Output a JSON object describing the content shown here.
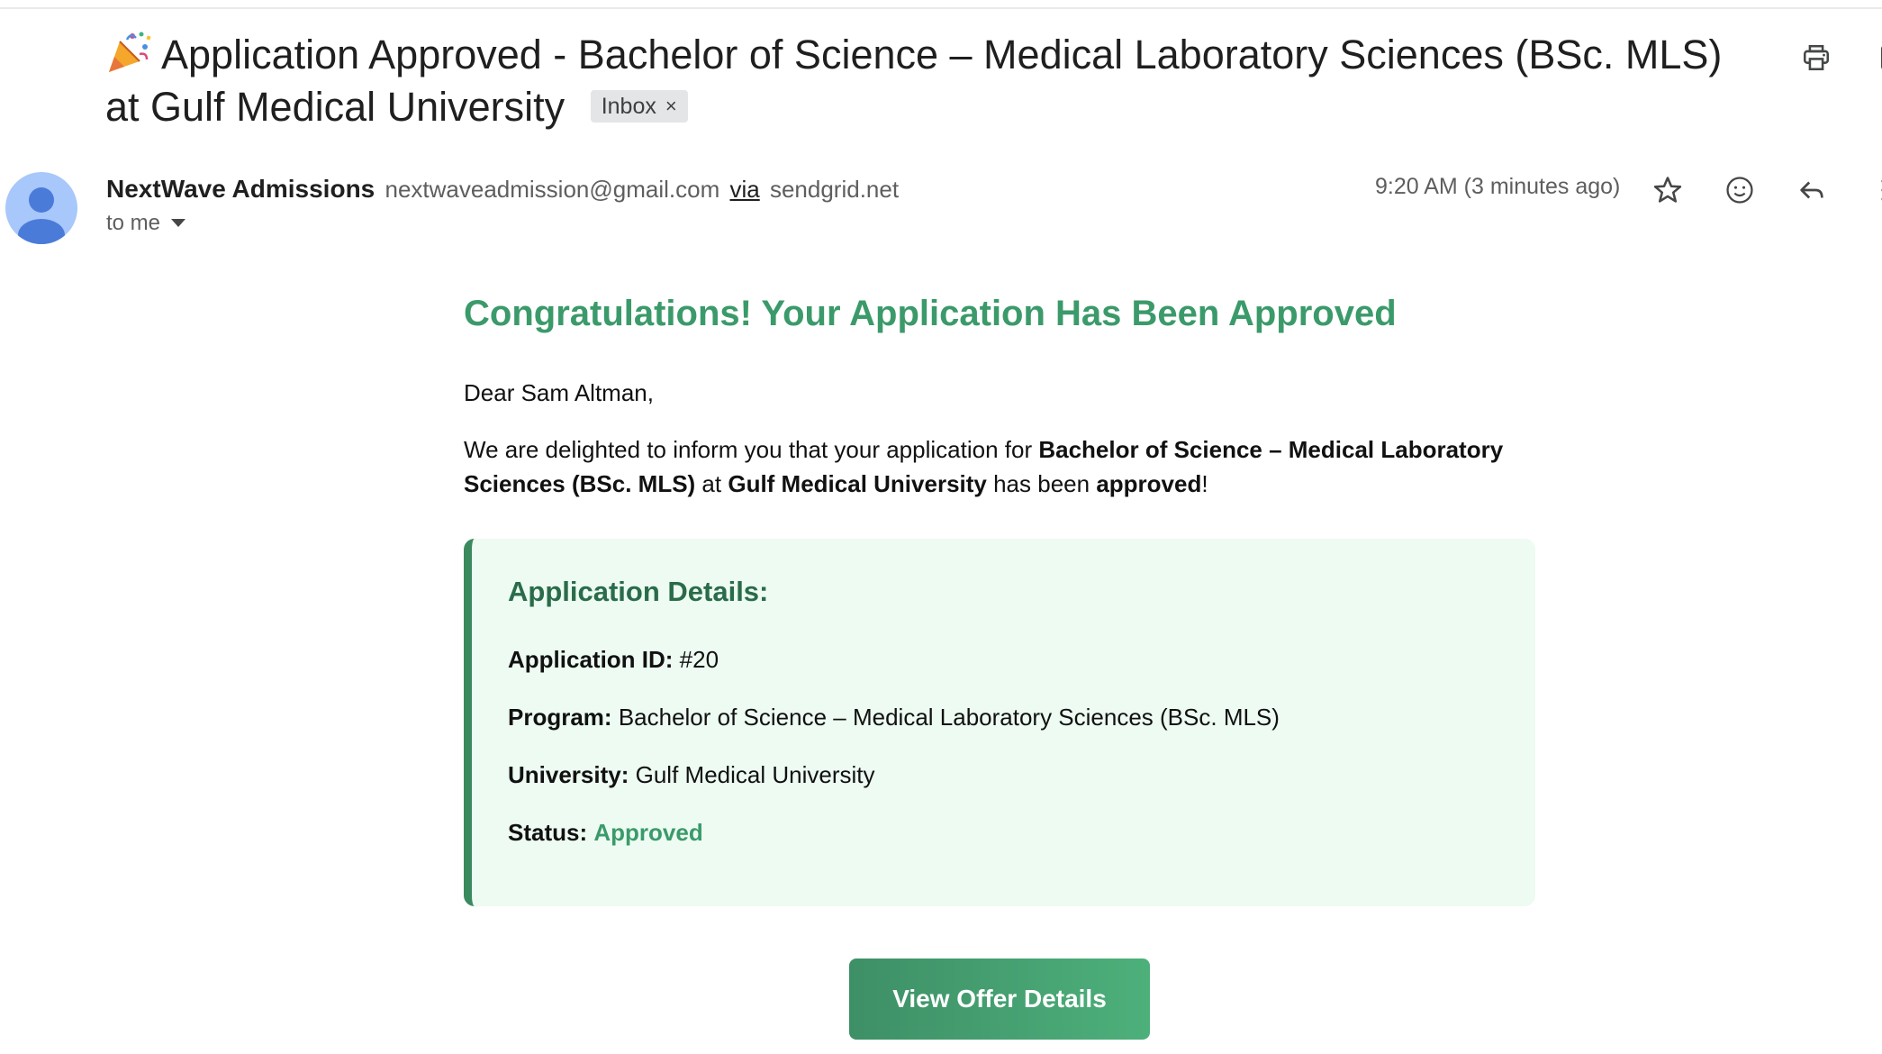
{
  "email": {
    "subject": "Application Approved - Bachelor of Science – Medical Laboratory Sciences (BSc. MLS) at Gulf Medical University",
    "subject_emoji": "party-popper-icon",
    "label_chip": "Inbox",
    "label_chip_close": "×"
  },
  "sender": {
    "name": "NextWave Admissions",
    "email": "nextwaveadmission@gmail.com",
    "via_label": "via",
    "via_domain": "sendgrid.net",
    "recipient": "to me",
    "timestamp": "9:20 AM (3 minutes ago)"
  },
  "icons": {
    "top_actions": [
      "print-icon",
      "open-in-new-window-icon"
    ],
    "row_actions": [
      "star-icon",
      "emoji-reaction-icon",
      "reply-icon",
      "more-options-icon"
    ]
  },
  "body": {
    "heading": "Congratulations! Your Application Has Been Approved",
    "greeting": "Dear Sam Altman,",
    "intro_pre": "We are delighted to inform you that your application for ",
    "intro_program": "Bachelor of Science – Medical Laboratory Sciences (BSc. MLS)",
    "intro_at": " at ",
    "intro_university": "Gulf Medical University",
    "intro_has_been": " has been ",
    "intro_status": "approved",
    "intro_end": "!"
  },
  "details": {
    "title": "Application Details:",
    "rows": [
      {
        "label": "Application ID:",
        "value": "#20"
      },
      {
        "label": "Program:",
        "value": "Bachelor of Science – Medical Laboratory Sciences (BSc. MLS)"
      },
      {
        "label": "University:",
        "value": "Gulf Medical University"
      },
      {
        "label": "Status:",
        "value": "Approved"
      }
    ]
  },
  "cta": {
    "label": "View Offer Details"
  },
  "colors": {
    "accent_green": "#3b9a6a",
    "card_bg": "#edfbf2",
    "card_border": "#3b8a5f",
    "avatar_bg": "#a8c7fa",
    "avatar_fg": "#4b7bd9"
  }
}
